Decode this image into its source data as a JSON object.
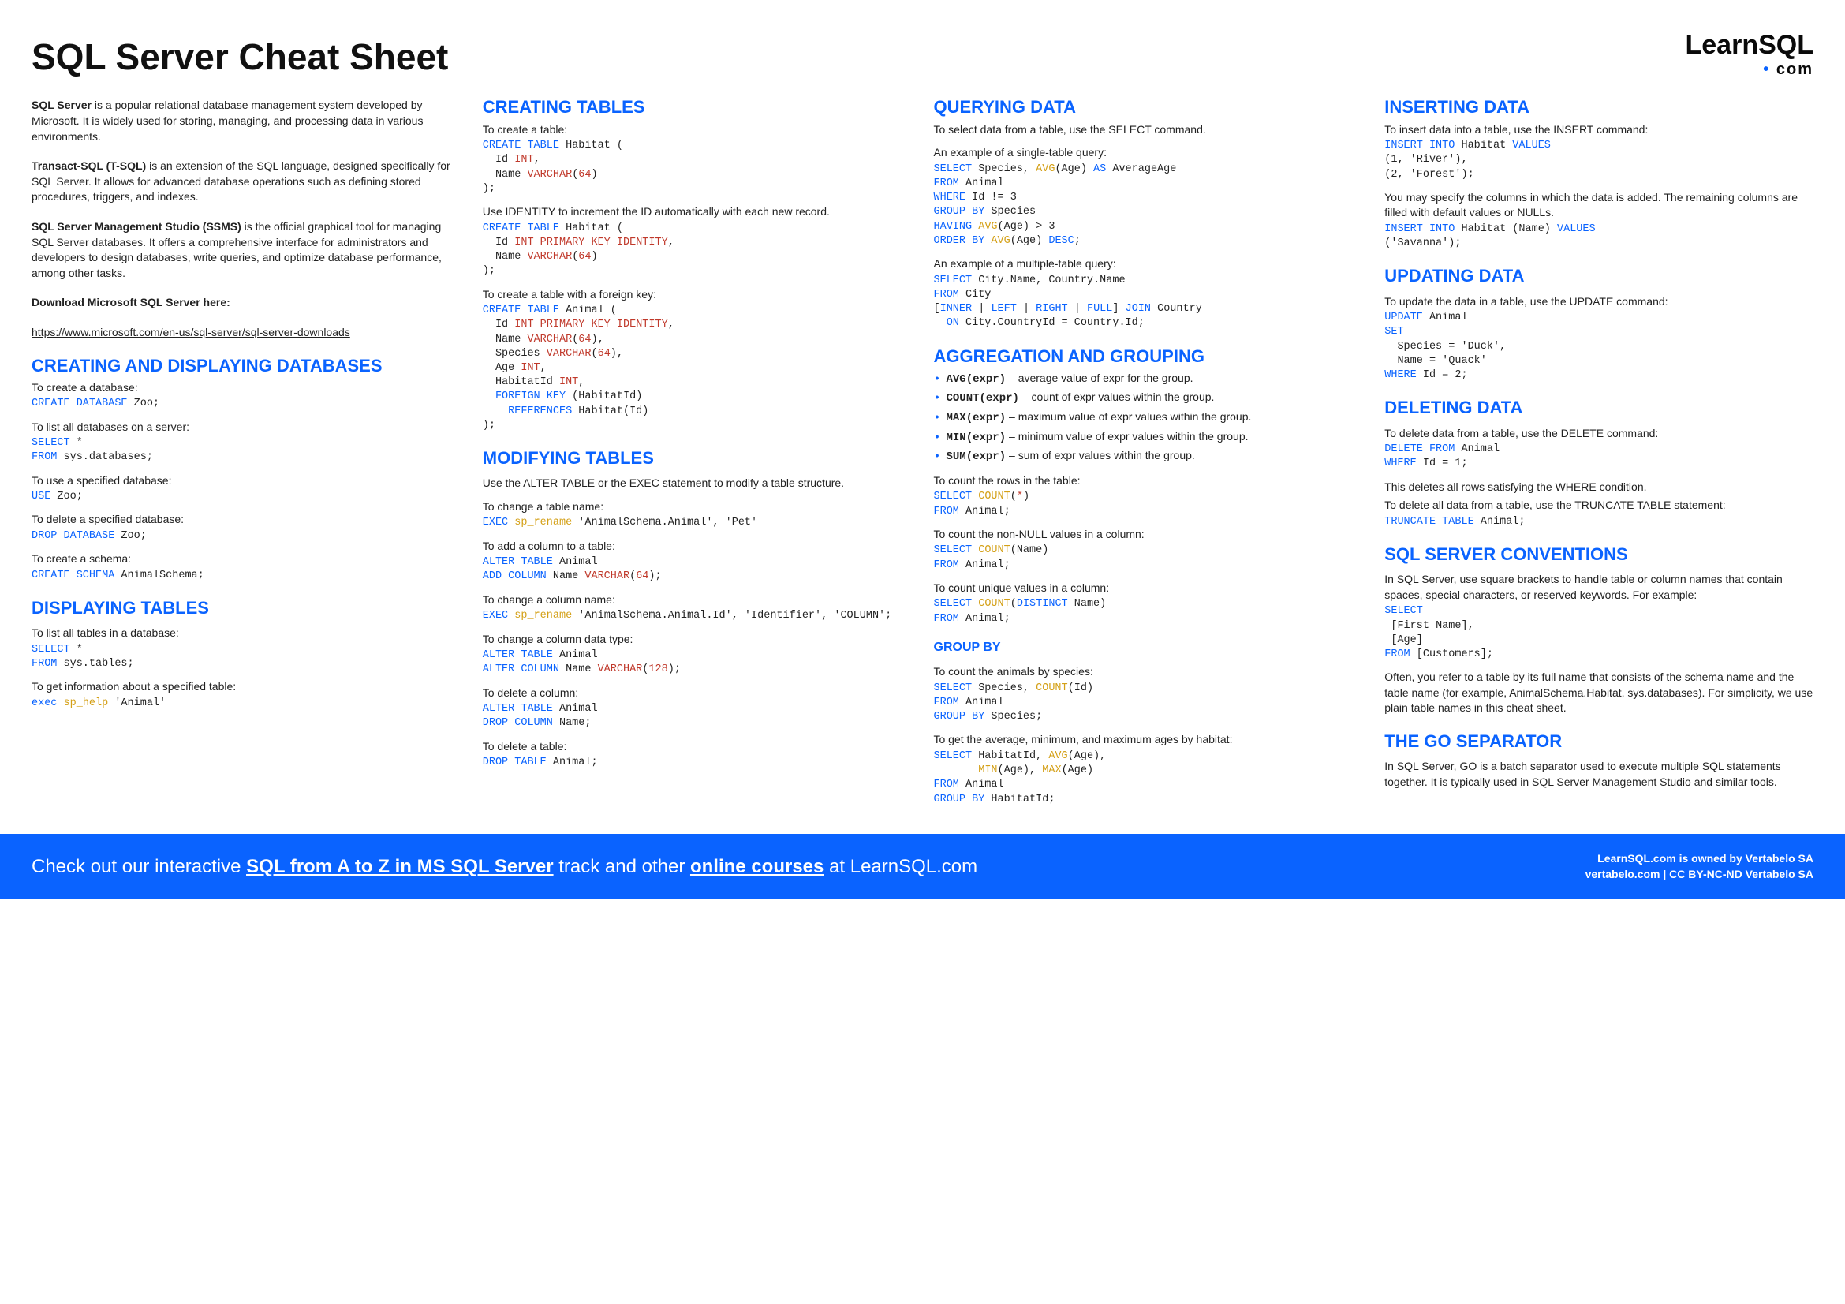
{
  "page_title": "SQL Server Cheat Sheet",
  "logo": {
    "learn": "Learn",
    "sql": "SQL",
    "dot": "•",
    "com": "com"
  },
  "intro": {
    "p1": {
      "bold": "SQL Server",
      "rest": " is a popular relational database management system developed by Microsoft. It is widely used for storing, managing, and processing data in various environments."
    },
    "p2": {
      "bold": "Transact-SQL (T-SQL)",
      "rest": " is an extension of the SQL language, designed specifically for SQL Server. It allows for advanced database operations such as defining stored procedures, triggers, and indexes."
    },
    "p3": {
      "bold": "SQL Server Management Studio (SSMS)",
      "rest": " is the official graphical tool for managing SQL Server databases. It offers a comprehensive interface for administrators and developers to design databases, write queries, and optimize database performance, among other tasks."
    },
    "download_label": "Download Microsoft SQL Server here:",
    "download_link": "https://www.microsoft.com/en-us/sql-server/sql-server-downloads"
  },
  "creating_db": {
    "title": "CREATING AND DISPLAYING DATABASES",
    "create_desc": "To create a database:",
    "list_desc": "To list all databases on a server:",
    "use_desc": "To use a specified database:",
    "delete_desc": "To delete a specified database:",
    "schema_desc": "To create a schema:"
  },
  "displaying_tables": {
    "title": "DISPLAYING TABLES",
    "list_desc": "To list all tables in a database:",
    "info_desc": "To get information about a specified table:"
  },
  "creating_tables": {
    "title": "CREATING TABLES",
    "create_desc": "To create a table:",
    "identity_desc": "Use IDENTITY to increment the ID automatically with each new record.",
    "fk_desc": "To create a table with a foreign key:"
  },
  "modifying_tables": {
    "title": "MODIFYING TABLES",
    "intro": "Use the ALTER TABLE or the EXEC statement to modify a table structure.",
    "rename_table_desc": "To change a table name:",
    "add_col_desc": "To add a column to a table:",
    "rename_col_desc": "To change a column name:",
    "change_type_desc": "To change a column data type:",
    "delete_col_desc": "To delete a column:",
    "delete_table_desc": "To delete a table:"
  },
  "querying": {
    "title": "QUERYING DATA",
    "intro": "To select data from a table, use the SELECT command.",
    "single_desc": "An example of a single-table query:",
    "multi_desc": "An example of a multiple-table query:"
  },
  "aggregation": {
    "title": "AGGREGATION AND GROUPING",
    "items": [
      {
        "fn": "AVG(expr)",
        "desc": " – average value of expr for the group."
      },
      {
        "fn": "COUNT(expr)",
        "desc": " – count of expr values within the group."
      },
      {
        "fn": "MAX(expr)",
        "desc": " – maximum value of expr values within the group."
      },
      {
        "fn": "MIN(expr)",
        "desc": " – minimum value of expr values within the group."
      },
      {
        "fn": "SUM(expr)",
        "desc": " – sum of expr values within the group."
      }
    ],
    "count_rows_desc": "To count the rows in the table:",
    "count_nonnull_desc": "To count the non-NULL values in a column:",
    "count_unique_desc": "To count unique values in a column:"
  },
  "groupby": {
    "title": "GROUP BY",
    "count_species_desc": "To count the animals by species:",
    "avg_desc": "To get the average, minimum, and maximum ages by habitat:"
  },
  "inserting": {
    "title": "INSERTING DATA",
    "intro": "To insert data into a table, use the INSERT command:",
    "specify_desc": "You may specify the columns in which the data is added. The remaining columns are filled with default values or NULLs."
  },
  "updating": {
    "title": "UPDATING DATA",
    "intro": "To update the data in a table, use the UPDATE command:"
  },
  "deleting": {
    "title": "DELETING DATA",
    "intro": "To delete data from a table, use the DELETE command:",
    "where_note": "This deletes all rows satisfying the WHERE condition.",
    "truncate_desc": "To delete all data from a table, use the TRUNCATE TABLE statement:"
  },
  "conventions": {
    "title": "SQL SERVER CONVENTIONS",
    "intro": "In SQL Server, use square brackets to handle table or column names that contain spaces, special characters, or reserved keywords. For example:",
    "full_name": "Often, you refer to a table by its full name that consists of the schema name and the table name (for example, AnimalSchema.Habitat, sys.databases). For simplicity, we use plain table names in this cheat sheet."
  },
  "go": {
    "title": "THE GO SEPARATOR",
    "desc": "In SQL Server, GO is a batch separator used to execute multiple SQL statements together. It is typically used in SQL Server Management Studio and similar tools."
  },
  "footer": {
    "left_pre": "Check out our interactive ",
    "left_link1": "SQL from A to Z in MS SQL Server",
    "left_mid": " track and other ",
    "left_link2": "online courses",
    "left_post": " at LearnSQL.com",
    "right1": "LearnSQL.com is owned by Vertabelo SA",
    "right2": "vertabelo.com | CC BY-NC-ND Vertabelo SA"
  }
}
